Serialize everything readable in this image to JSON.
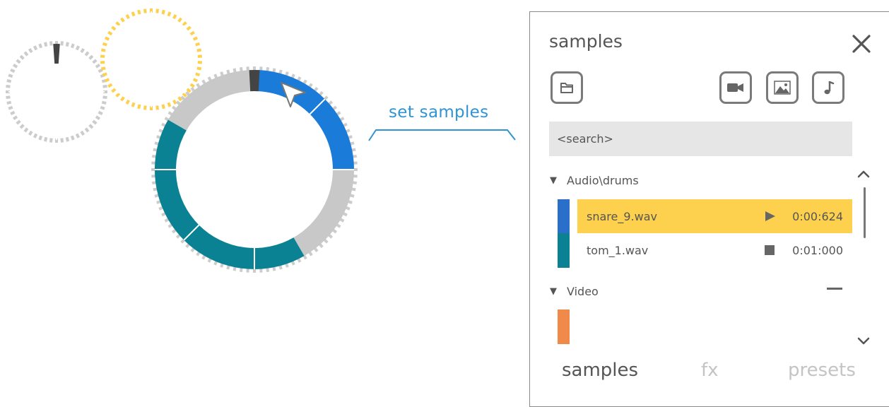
{
  "annotation": {
    "label": "set samples"
  },
  "gears": {
    "orange": {
      "colors": [
        "#f08a4b",
        "#f08a4b"
      ]
    },
    "yellow": {
      "colors": [
        "#fdd14d"
      ]
    },
    "main": {
      "colors": [
        "#1a7bd8",
        "#c8c8c8",
        "#0a8293",
        "#c8c8c8"
      ]
    },
    "tooth_color": "#cccccc",
    "playhead_color": "#444444"
  },
  "panel": {
    "title": "samples",
    "icons": {
      "close": "close-icon",
      "folder": "folder-icon",
      "video": "video-camera-icon",
      "image": "image-icon",
      "audio": "music-note-icon"
    },
    "search": {
      "placeholder": "<search>",
      "value": ""
    },
    "folders": [
      {
        "name": "Audio\\drums",
        "expanded": true,
        "files": [
          {
            "name": "snare_9.wav",
            "time": "0:00:624",
            "state": "playing",
            "selected": true,
            "color": "#2a6fc9"
          },
          {
            "name": "tom_1.wav",
            "time": "0:01:000",
            "state": "stopped",
            "selected": false,
            "color": "#0a8293"
          }
        ]
      },
      {
        "name": "Video",
        "expanded": true,
        "files": [],
        "swatch_color": "#f08a4b"
      }
    ],
    "tabs": [
      {
        "label": "samples",
        "active": true
      },
      {
        "label": "fx",
        "active": false
      },
      {
        "label": "presets",
        "active": false
      }
    ],
    "colors": {
      "accent_selected": "#fdd14d",
      "text": "#555555"
    }
  }
}
